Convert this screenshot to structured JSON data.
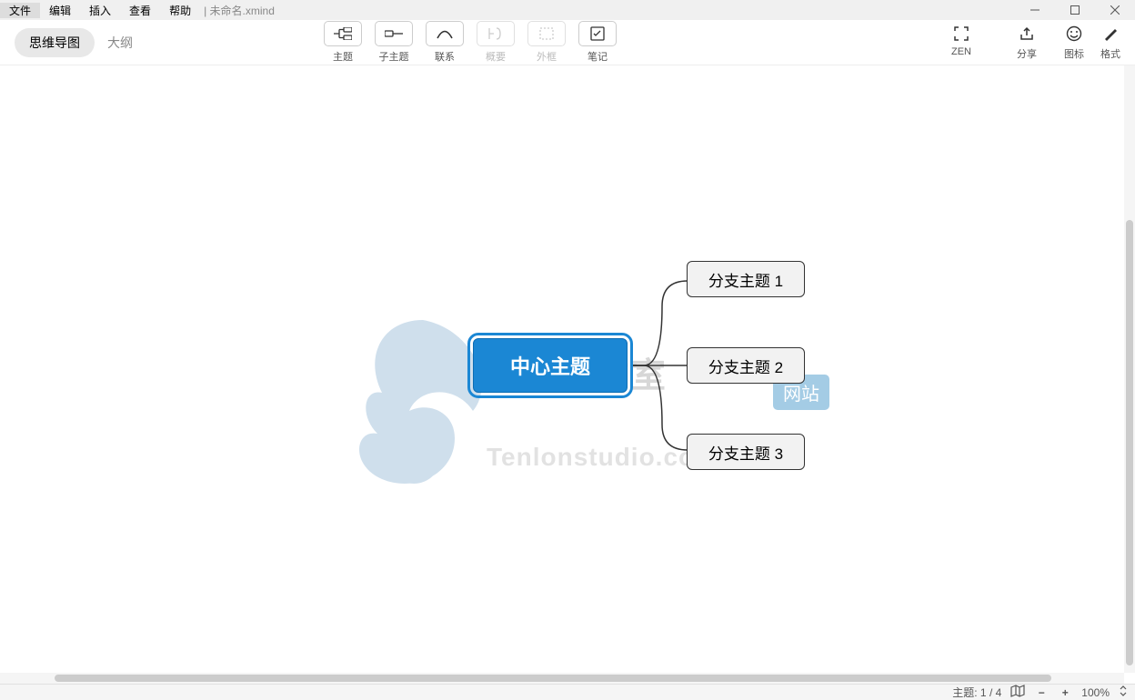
{
  "menubar": {
    "items": [
      "文件",
      "编辑",
      "插入",
      "查看",
      "帮助"
    ],
    "filename": "未命名.xmind"
  },
  "view": {
    "mindmap": "思维导图",
    "outline": "大纲"
  },
  "toolbar": {
    "topic": "主题",
    "subtopic": "子主题",
    "relation": "联系",
    "summary": "概要",
    "boundary": "外框",
    "notes": "笔记",
    "zen": "ZEN",
    "share": "分享",
    "markers": "图标",
    "format": "格式"
  },
  "mindmap": {
    "central": "中心主题",
    "branches": [
      "分支主题 1",
      "分支主题 2",
      "分支主题 3"
    ]
  },
  "watermark": {
    "title": "腾龙工作室",
    "badge": "网站",
    "url": "Tenlonstudio.com"
  },
  "status": {
    "topic_count": "主题: 1 / 4",
    "zoom": "100%",
    "minus": "−",
    "plus": "+"
  }
}
